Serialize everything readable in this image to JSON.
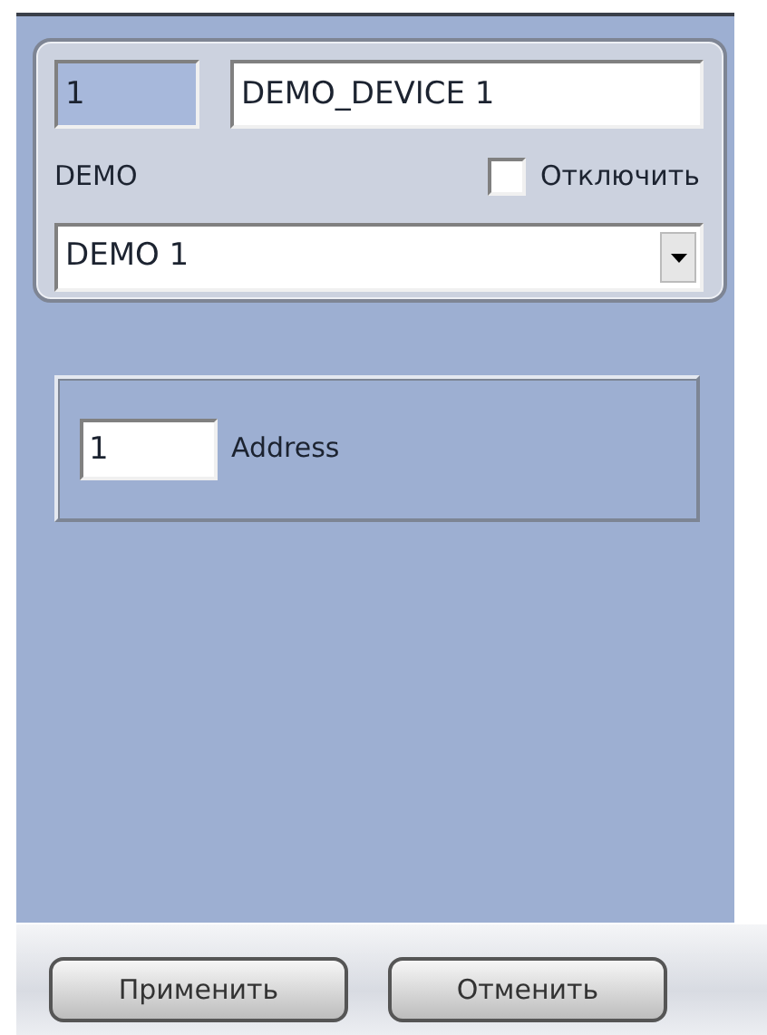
{
  "device": {
    "number": "1",
    "name": "DEMO_DEVICE 1",
    "type_label": "DEMO",
    "disabled_label": "Отключить",
    "disabled": false,
    "model": "DEMO 1"
  },
  "address": {
    "value": "1",
    "label": "Address"
  },
  "buttons": [
    {
      "label": "Применить"
    },
    {
      "label": "Отменить"
    }
  ]
}
